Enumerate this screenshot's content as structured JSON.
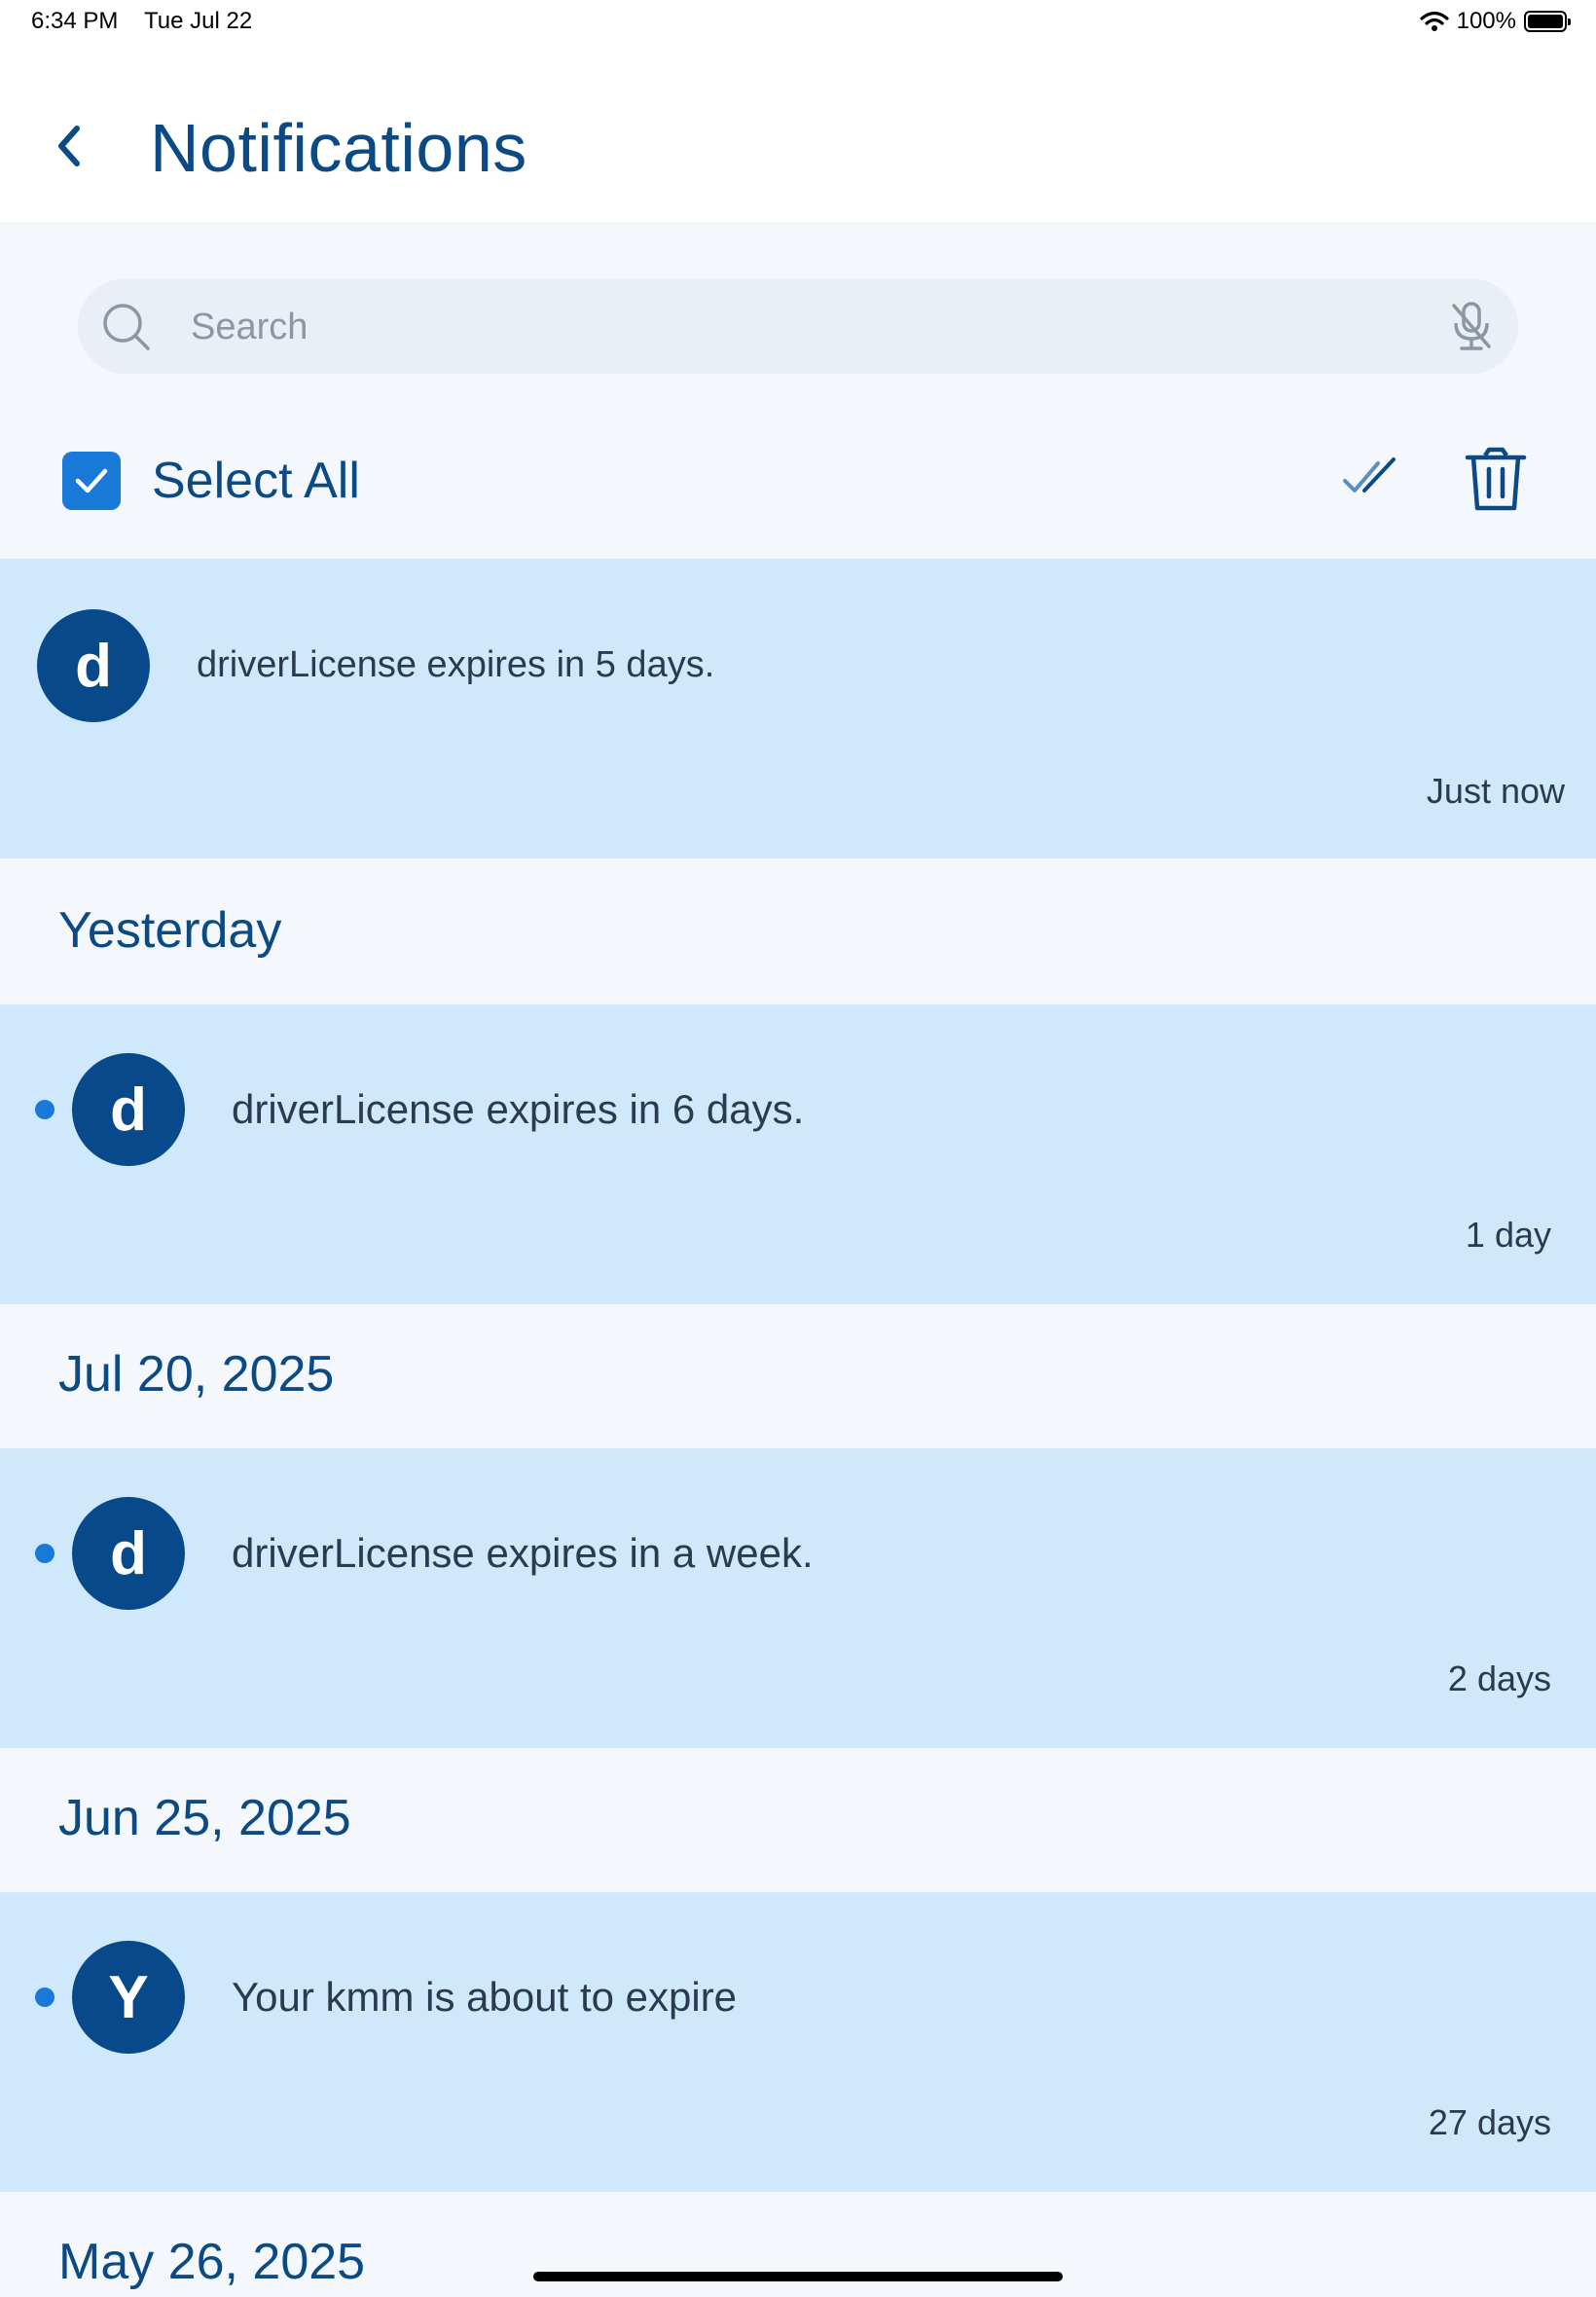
{
  "status_bar": {
    "time": "6:34 PM",
    "date": "Tue Jul 22",
    "battery": "100%",
    "battery_level": 1.0,
    "icons": [
      "wifi-icon",
      "battery-icon"
    ]
  },
  "header": {
    "title": "Notifications",
    "back_icon": "chevron-left-icon"
  },
  "search": {
    "placeholder": "Search",
    "value": "",
    "icons": [
      "search-icon",
      "mic-off-icon"
    ]
  },
  "toolbar": {
    "select_all_label": "Select All",
    "select_all_checked": true,
    "icons": [
      "double-check-icon",
      "trash-icon"
    ]
  },
  "notifications": [
    {
      "avatar": "d",
      "text": "driverLicense expires in 5 days.",
      "time": "Just now",
      "unread": false
    },
    {
      "section": "Yesterday",
      "avatar": "d",
      "text": "driverLicense expires in 6 days.",
      "time": "1 day",
      "unread": true
    },
    {
      "section": "Jul 20, 2025",
      "avatar": "d",
      "text": "driverLicense expires in a week.",
      "time": "2 days",
      "unread": true
    },
    {
      "section": "Jun 25, 2025",
      "avatar": "Y",
      "text": "Your kmm is about to expire",
      "time": "27 days",
      "unread": true
    }
  ],
  "trailing_section": "May 26, 2025",
  "colors": {
    "accent": "#1879d6",
    "title": "#0b4a85",
    "avatar": "#07498a",
    "card_background": "#d0e8fb",
    "page_background": "#f4f7fb"
  }
}
